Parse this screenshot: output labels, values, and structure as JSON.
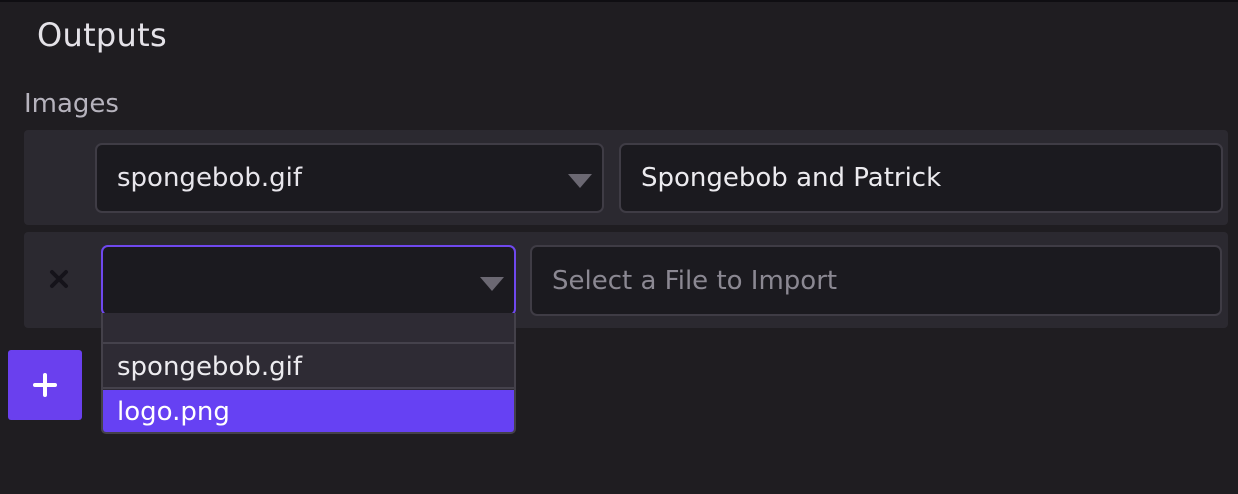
{
  "section": {
    "title": "Outputs"
  },
  "images": {
    "label": "Images",
    "rows": [
      {
        "select_value": "spongebob.gif",
        "title_value": "Spongebob and Patrick",
        "title_placeholder": ""
      },
      {
        "select_value": "",
        "title_value": "",
        "title_placeholder": "Select a File to Import"
      }
    ]
  },
  "dropdown": {
    "options": [
      "",
      "spongebob.gif",
      "logo.png"
    ],
    "highlighted": "logo.png"
  },
  "icons": {
    "remove": "close-icon",
    "add": "plus-icon",
    "caret": "caret-down-icon"
  },
  "colors": {
    "accent": "#6a40ee",
    "focus_border": "#6f48ee",
    "highlight": "#6641f3",
    "background": "#1f1d21",
    "row_background": "#2b2930",
    "input_background": "#1b1a1f"
  }
}
